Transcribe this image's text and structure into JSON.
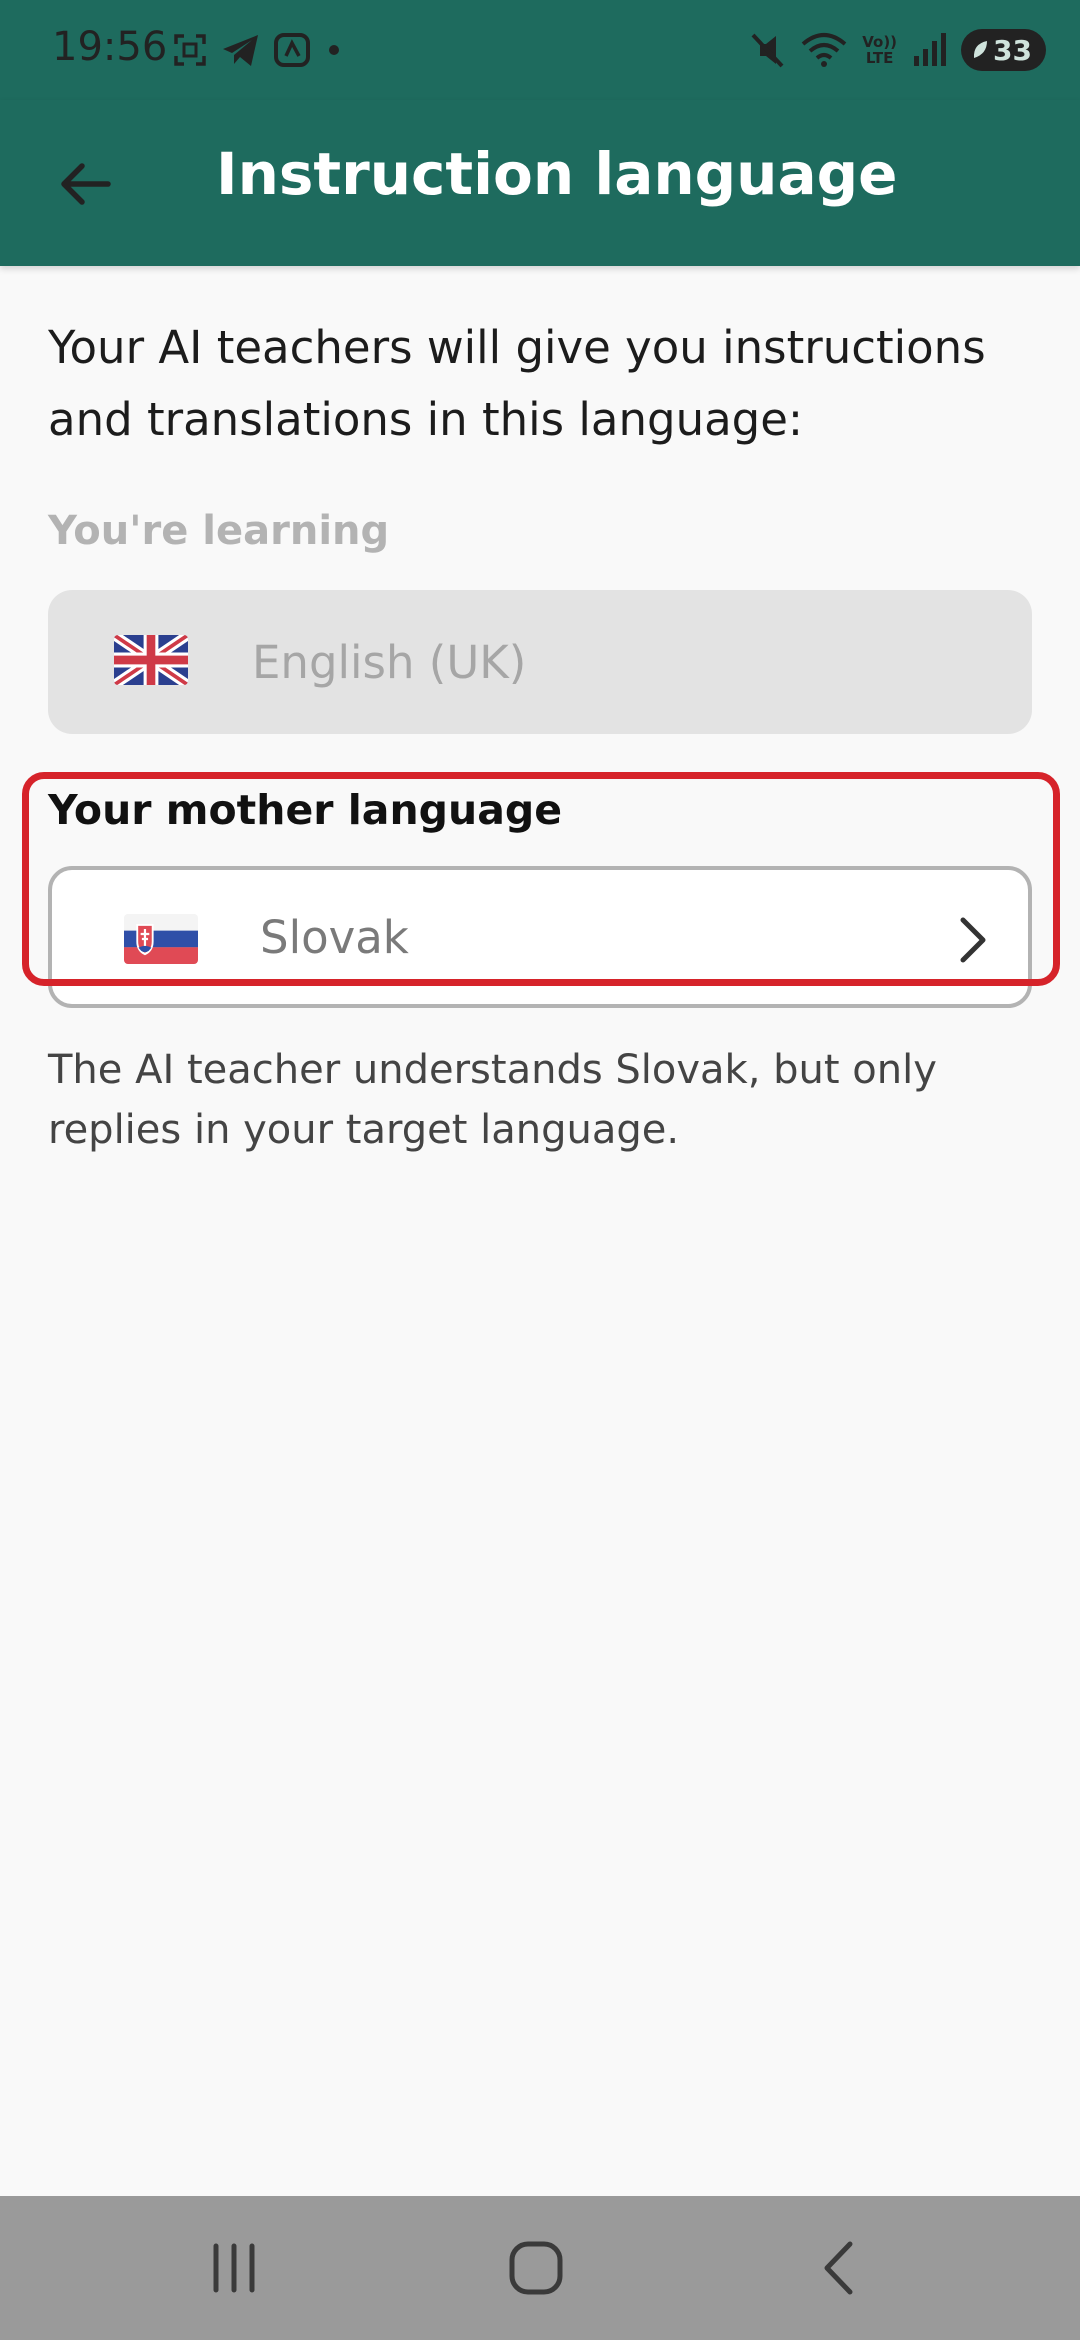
{
  "status_bar": {
    "time": "19:56",
    "battery_level": "33",
    "network_label_top": "Vo))",
    "network_label_bottom": "LTE"
  },
  "app_bar": {
    "title": "Instruction language"
  },
  "content": {
    "intro_text": "Your AI teachers will give you instructions and translations in this language:",
    "learning_label": "You're learning",
    "learning_language": "English (UK)",
    "mother_label": "Your mother language",
    "mother_language": "Slovak",
    "helper_text": "The AI teacher understands Slovak, but only replies in your target language."
  },
  "colors": {
    "app_bar": "#1e6b5e",
    "highlight": "#d6232a",
    "background": "#f9f9f9",
    "nav_bar": "#9a9a9a"
  }
}
